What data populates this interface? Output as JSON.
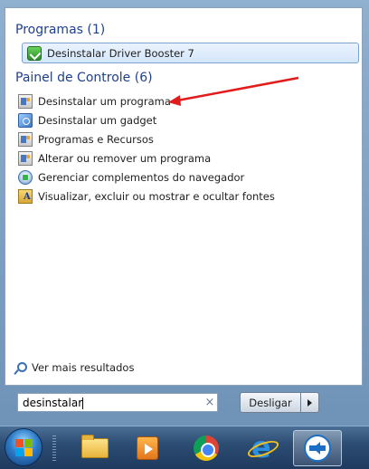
{
  "programs_section": {
    "header": "Programas (1)",
    "items": [
      {
        "label": "Desinstalar Driver Booster 7",
        "icon": "driver-booster-icon"
      }
    ]
  },
  "control_panel_section": {
    "header": "Painel de Controle (6)",
    "items": [
      {
        "label": "Desinstalar um programa",
        "icon": "control-panel-icon"
      },
      {
        "label": "Desinstalar um gadget",
        "icon": "gadget-icon"
      },
      {
        "label": "Programas e Recursos",
        "icon": "control-panel-icon"
      },
      {
        "label": "Alterar ou remover um programa",
        "icon": "control-panel-icon"
      },
      {
        "label": "Gerenciar complementos do navegador",
        "icon": "browser-addon-icon"
      },
      {
        "label": "Visualizar, excluir ou mostrar e ocultar fontes",
        "icon": "fonts-folder-icon"
      }
    ]
  },
  "more_results_label": "Ver mais resultados",
  "search": {
    "value": "desinstalar",
    "clear_glyph": "×"
  },
  "shutdown": {
    "label": "Desligar"
  },
  "colors": {
    "section_header": "#1f3f8f",
    "annotation_arrow": "#e21b1b",
    "selection_border": "#7da2ce"
  },
  "taskbar": {
    "pinned": [
      {
        "icon": "file-explorer-icon"
      },
      {
        "icon": "media-player-icon"
      },
      {
        "icon": "chrome-icon"
      },
      {
        "icon": "internet-explorer-icon"
      },
      {
        "icon": "teamviewer-icon",
        "active": true
      }
    ]
  }
}
